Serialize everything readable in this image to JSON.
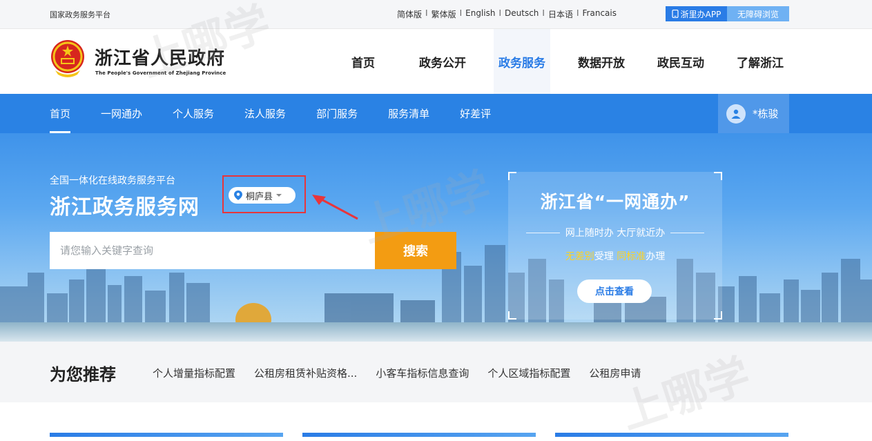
{
  "topbar": {
    "site_name": "国家政务服务平台",
    "languages": [
      "简体版",
      "繁体版",
      "English",
      "Deutsch",
      "日本语",
      "Francais"
    ],
    "separator": "I",
    "app_button": "浙里办APP",
    "accessibility_button": "无障碍浏览"
  },
  "header": {
    "title": "浙江省人民政府",
    "subtitle": "The People's Government of Zhejiang Province",
    "nav": [
      {
        "label": "首页",
        "active": false
      },
      {
        "label": "政务公开",
        "active": false
      },
      {
        "label": "政务服务",
        "active": true
      },
      {
        "label": "数据开放",
        "active": false
      },
      {
        "label": "政民互动",
        "active": false
      },
      {
        "label": "了解浙江",
        "active": false
      }
    ]
  },
  "subnav": {
    "links": [
      {
        "label": "首页",
        "active": true
      },
      {
        "label": "一网通办",
        "active": false
      },
      {
        "label": "个人服务",
        "active": false
      },
      {
        "label": "法人服务",
        "active": false
      },
      {
        "label": "部门服务",
        "active": false
      },
      {
        "label": "服务清单",
        "active": false
      },
      {
        "label": "好差评",
        "active": false
      }
    ],
    "user_name": "*栋骏"
  },
  "hero": {
    "subtitle": "全国一体化在线政务服务平台",
    "title": "浙江政务服务网",
    "location": "桐庐县",
    "search_placeholder": "请您输入关键字查询",
    "search_button": "搜索"
  },
  "promo": {
    "title": "浙江省“一网通办”",
    "line": "网上随时办  大厅就近办",
    "tag_hl1": "无差别",
    "tag_mid": "受理 ",
    "tag_hl2": "同标准",
    "tag_end": "办理",
    "button": "点击查看"
  },
  "recommend": {
    "title": "为您推荐",
    "items": [
      "个人增量指标配置",
      "公租房租赁补贴资格...",
      "小客车指标信息查询",
      "个人区域指标配置",
      "公租房申请"
    ]
  },
  "watermark": "上哪学",
  "colors": {
    "primary": "#2a82e4",
    "accent_orange": "#f39c12",
    "highlight_yellow": "#ffd21f",
    "annotation_red": "#e8353b"
  }
}
